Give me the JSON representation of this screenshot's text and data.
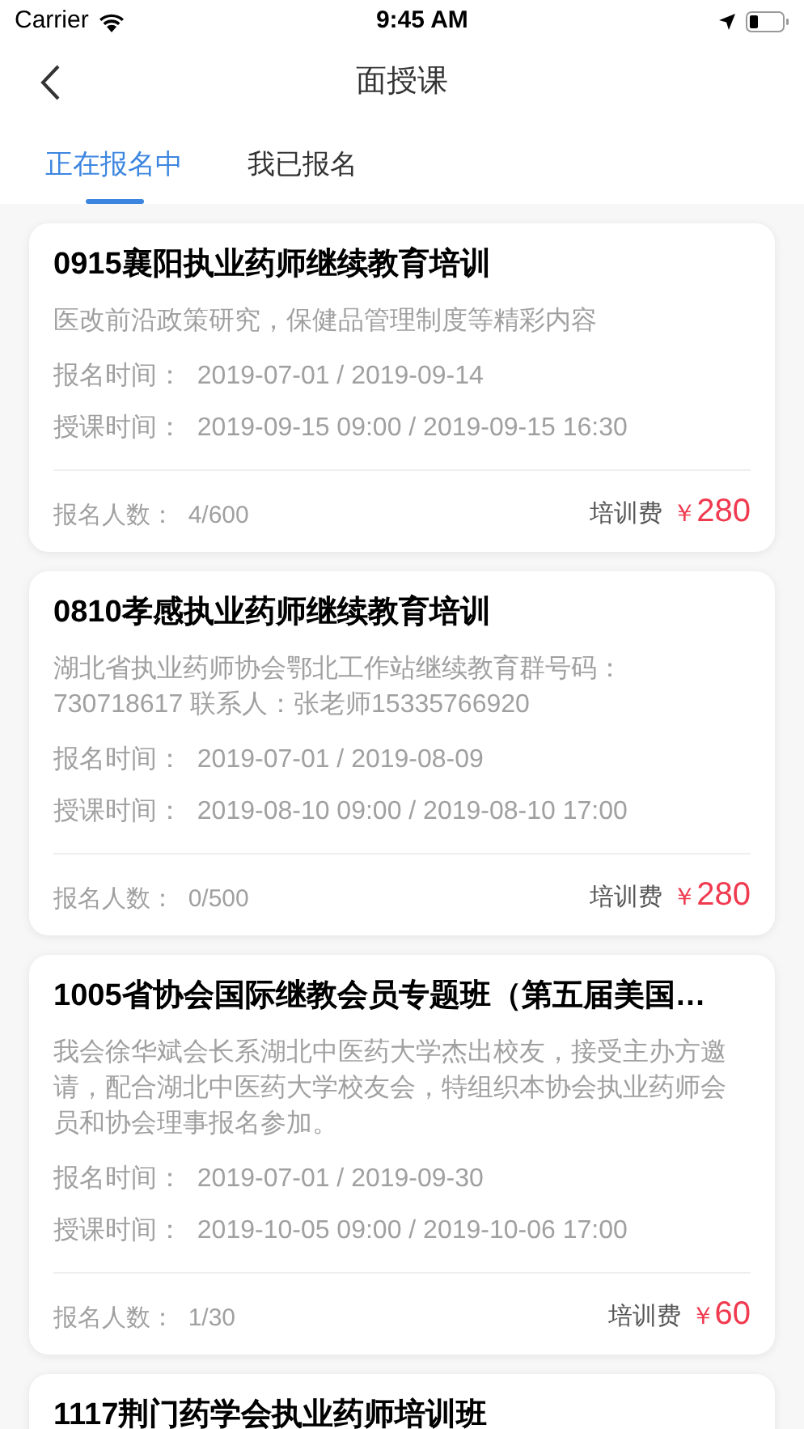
{
  "status_bar": {
    "carrier": "Carrier",
    "time": "9:45 AM"
  },
  "nav": {
    "title": "面授课"
  },
  "tabs": [
    {
      "label": "正在报名中",
      "selected": true
    },
    {
      "label": "我已报名",
      "selected": false
    }
  ],
  "courses": [
    {
      "title": "0915襄阳执业药师继续教育培训",
      "description": "医改前沿政策研究，保健品管理制度等精彩内容",
      "signup_time": "报名时间：  2019-07-01 / 2019-09-14",
      "class_time": "授课时间：  2019-09-15 09:00 / 2019-09-15 16:30",
      "enrolled": "报名人数：  4/600",
      "fee_label": "培训费",
      "currency": "￥",
      "fee": "280"
    },
    {
      "title": "0810孝感执业药师继续教育培训",
      "description": "湖北省执业药师协会鄂北工作站继续教育群号码：\n730718617   联系人：张老师15335766920",
      "signup_time": "报名时间：  2019-07-01 / 2019-08-09",
      "class_time": "授课时间：  2019-08-10 09:00 / 2019-08-10 17:00",
      "enrolled": "报名人数：  0/500",
      "fee_label": "培训费",
      "currency": "￥",
      "fee": "280"
    },
    {
      "title": "1005省协会国际继教会员专题班（第五届美国…",
      "description": "我会徐华斌会长系湖北中医药大学杰出校友，接受主办方邀请，配合湖北中医药大学校友会，特组织本协会执业药师会员和协会理事报名参加。",
      "signup_time": "报名时间：  2019-07-01 / 2019-09-30",
      "class_time": "授课时间：  2019-10-05 09:00 / 2019-10-06 17:00",
      "enrolled": "报名人数：  1/30",
      "fee_label": "培训费",
      "currency": "￥",
      "fee": "60"
    },
    {
      "title": "1117荆门药学会执业药师培训班"
    }
  ]
}
